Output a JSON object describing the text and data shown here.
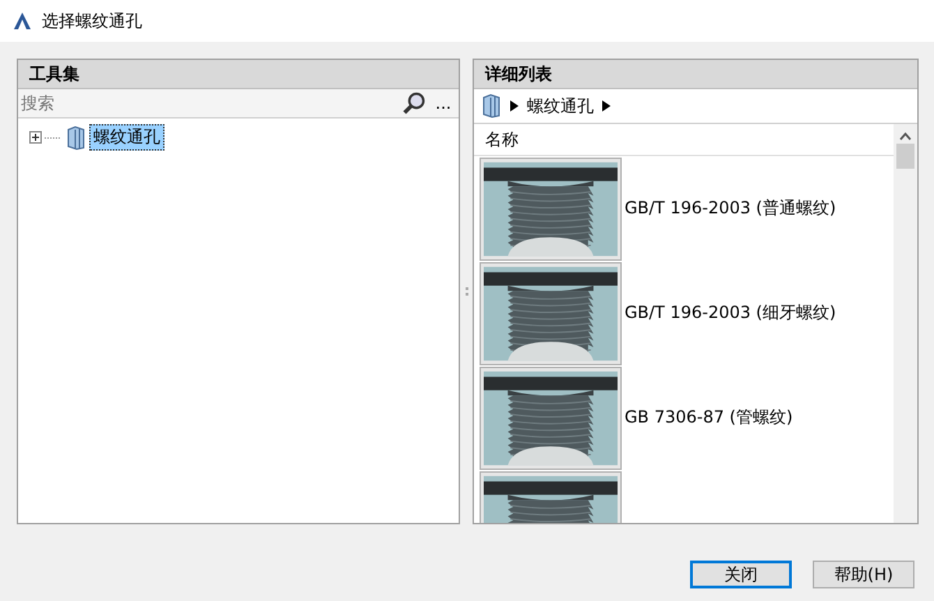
{
  "window": {
    "title": "选择螺纹通孔"
  },
  "left_panel": {
    "title": "工具集",
    "search": {
      "placeholder": "搜索"
    },
    "more_button": "...",
    "tree": [
      {
        "label": "螺纹通孔",
        "selected": true,
        "expanded": false
      }
    ]
  },
  "right_panel": {
    "title": "详细列表",
    "breadcrumb": [
      "螺纹通孔"
    ],
    "column": "名称",
    "items": [
      {
        "kind": "thread",
        "label": "GB/T 196-2003  (普通螺纹)"
      },
      {
        "kind": "thread",
        "label": "GB/T 196-2003  (细牙螺纹)"
      },
      {
        "kind": "thread",
        "label": "GB 7306-87  (管螺纹)"
      },
      {
        "kind": "thread"
      }
    ]
  },
  "buttons": [
    {
      "label": "关闭",
      "default": true
    },
    {
      "label": "帮助(H)",
      "default": false
    }
  ]
}
